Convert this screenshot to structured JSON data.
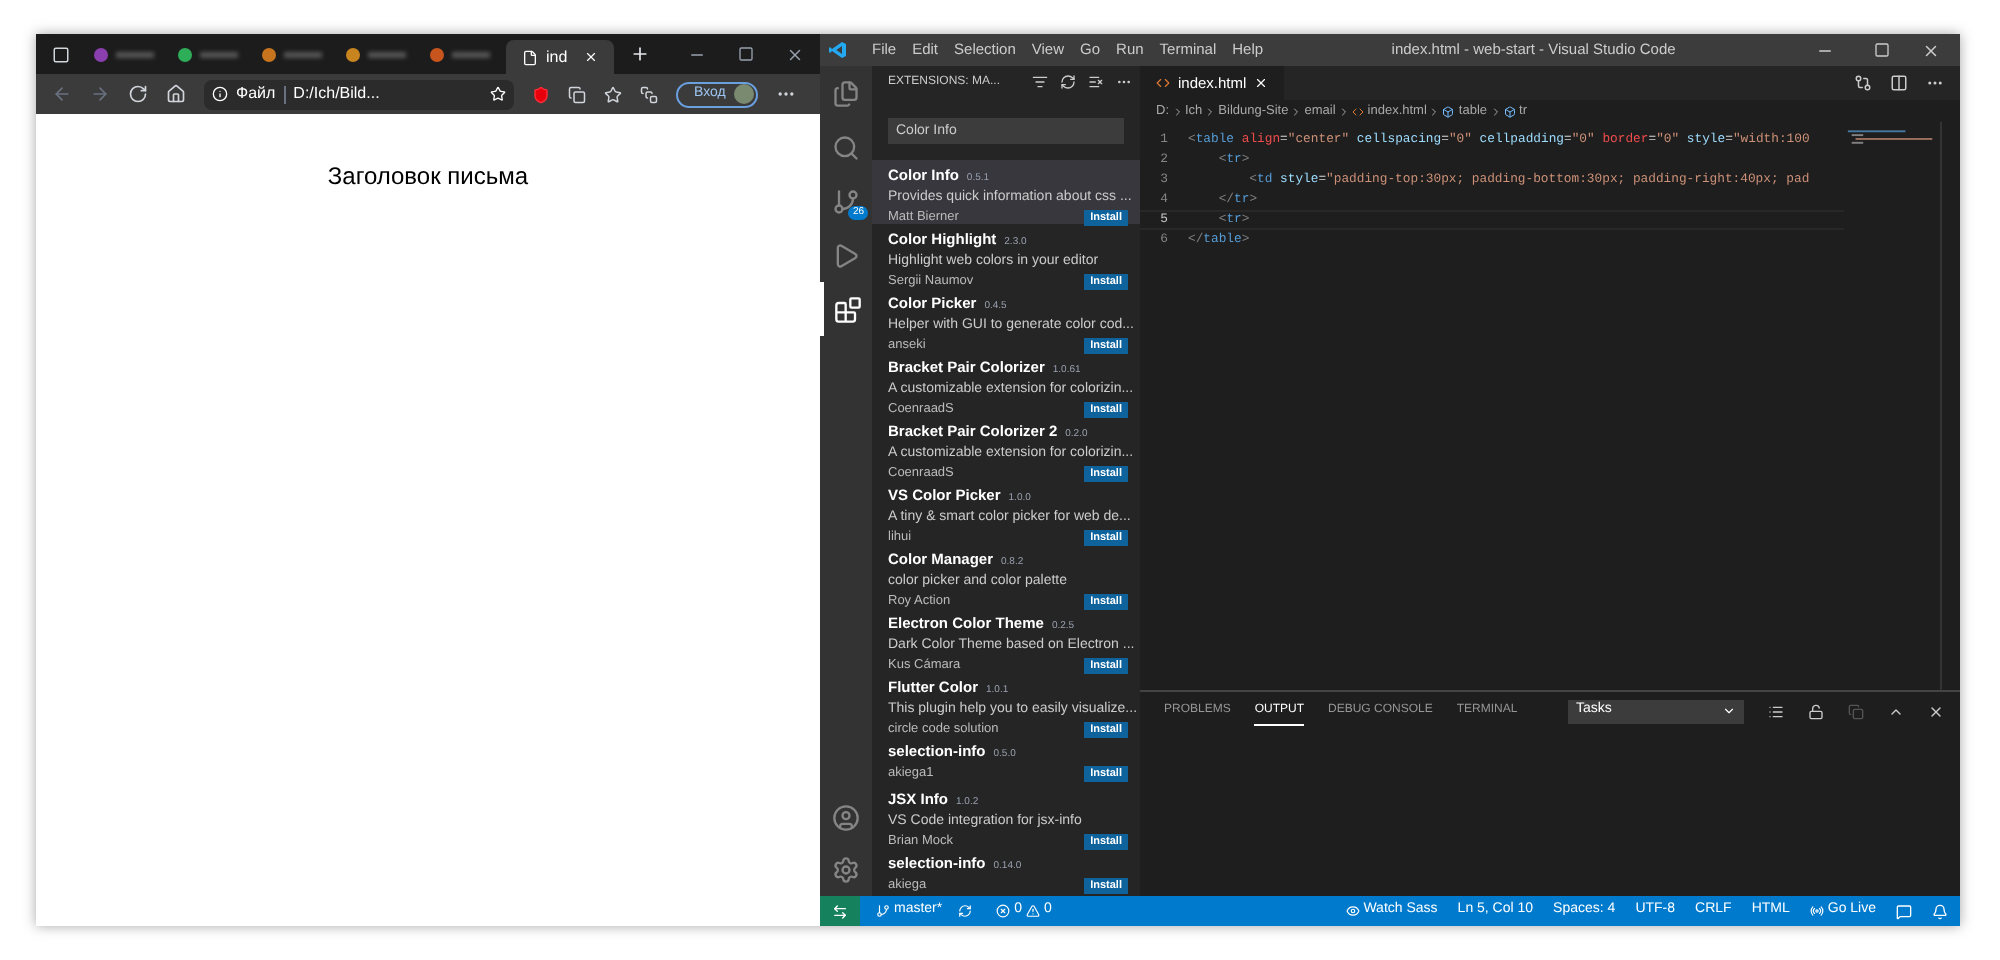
{
  "browser": {
    "blurred_tabs": [
      {
        "color": "#8a3fae"
      },
      {
        "color": "#2fae5a"
      },
      {
        "color": "#c8741e"
      },
      {
        "color": "#c8841e"
      },
      {
        "color": "#c8541e"
      }
    ],
    "active_tab": {
      "title": "ind",
      "selected": true
    },
    "address": {
      "scheme": "Файл",
      "url": "D:/Ich/Bild..."
    },
    "profile": {
      "label": "Вход"
    },
    "page": {
      "heading": "Заголовок письма"
    }
  },
  "vscode": {
    "menu": [
      "File",
      "Edit",
      "Selection",
      "View",
      "Go",
      "Run",
      "Terminal",
      "Help"
    ],
    "title": "index.html - web-start - Visual Studio Code",
    "activity": [
      {
        "kind": "files",
        "selected": false
      },
      {
        "kind": "search",
        "selected": false
      },
      {
        "kind": "scm",
        "selected": false,
        "badge": "26"
      },
      {
        "kind": "debug",
        "selected": false
      },
      {
        "kind": "extensions",
        "selected": true
      }
    ],
    "sidebar": {
      "title": "EXTENSIONS: MA...",
      "search": {
        "value": "Color Info"
      },
      "extensions": [
        {
          "name": "Color Info",
          "version": "0.5.1",
          "description": "Provides quick information about css ...",
          "author": "Matt Bierner",
          "button": "Install",
          "selected": true
        },
        {
          "name": "Color Highlight",
          "version": "2.3.0",
          "description": "Highlight web colors in your editor",
          "author": "Sergii Naumov",
          "button": "Install",
          "selected": false
        },
        {
          "name": "Color Picker",
          "version": "0.4.5",
          "description": "Helper with GUI to generate color cod...",
          "author": "anseki",
          "button": "Install",
          "selected": false
        },
        {
          "name": "Bracket Pair Colorizer",
          "version": "1.0.61",
          "description": "A customizable extension for colorizin...",
          "author": "CoenraadS",
          "button": "Install",
          "selected": false
        },
        {
          "name": "Bracket Pair Colorizer 2",
          "version": "0.2.0",
          "description": "A customizable extension for colorizin...",
          "author": "CoenraadS",
          "button": "Install",
          "selected": false
        },
        {
          "name": "VS Color Picker",
          "version": "1.0.0",
          "description": "A tiny & smart color picker for web de...",
          "author": "lihui",
          "button": "Install",
          "selected": false
        },
        {
          "name": "Color Manager",
          "version": "0.8.2",
          "description": "color picker and color palette",
          "author": "Roy Action",
          "button": "Install",
          "selected": false
        },
        {
          "name": "Electron Color Theme",
          "version": "0.2.5",
          "description": "Dark Color Theme based on Electron ...",
          "author": "Kus Cámara",
          "button": "Install",
          "selected": false
        },
        {
          "name": "Flutter Color",
          "version": "1.0.1",
          "description": "This plugin help you to easily visualize...",
          "author": "circle code solution",
          "button": "Install",
          "selected": false
        },
        {
          "name": "selection-info",
          "version": "0.5.0",
          "author": "akiega1",
          "button": "Install",
          "selected": false
        },
        {
          "name": "JSX Info",
          "version": "1.0.2",
          "description": "VS Code integration for jsx-info",
          "author": "Brian Mock",
          "button": "Install",
          "selected": false
        },
        {
          "name": "selection-info",
          "version": "0.14.0",
          "author": "akiega",
          "button": "Install",
          "selected": false
        }
      ]
    },
    "editor": {
      "tab": {
        "label": "index.html",
        "selected": true
      },
      "breadcrumbs": [
        {
          "kind": "folder",
          "label": "D:"
        },
        {
          "kind": "folder",
          "label": "Ich"
        },
        {
          "kind": "folder",
          "label": "Bildung-Site"
        },
        {
          "kind": "folder",
          "label": "email"
        },
        {
          "kind": "file",
          "label": "index.html"
        },
        {
          "kind": "symbol",
          "label": "table"
        },
        {
          "kind": "symbol",
          "label": "tr"
        }
      ],
      "lines": [
        {
          "number": "1",
          "active": false,
          "tokens": [
            {
              "kind": "p",
              "text": "<"
            },
            {
              "kind": "t",
              "text": "table"
            },
            {
              "kind": "w",
              "text": " align"
            },
            {
              "kind": "x",
              "text": "="
            },
            {
              "kind": "s",
              "text": "\"center\""
            },
            {
              "kind": "a",
              "text": " cellspacing"
            },
            {
              "kind": "x",
              "text": "="
            },
            {
              "kind": "s",
              "text": "\"0\""
            },
            {
              "kind": "a",
              "text": " cellpadding"
            },
            {
              "kind": "x",
              "text": "="
            },
            {
              "kind": "s",
              "text": "\"0\""
            },
            {
              "kind": "w",
              "text": " border"
            },
            {
              "kind": "x",
              "text": "="
            },
            {
              "kind": "s",
              "text": "\"0\""
            },
            {
              "kind": "a",
              "text": " style"
            },
            {
              "kind": "x",
              "text": "="
            },
            {
              "kind": "s",
              "text": "\"width:100"
            }
          ]
        },
        {
          "number": "2",
          "active": false,
          "tokens": [
            {
              "kind": "p",
              "text": "    <"
            },
            {
              "kind": "t",
              "text": "tr"
            },
            {
              "kind": "p",
              "text": ">"
            }
          ]
        },
        {
          "number": "3",
          "active": false,
          "tokens": [
            {
              "kind": "p",
              "text": "        <"
            },
            {
              "kind": "t",
              "text": "td"
            },
            {
              "kind": "a",
              "text": " style"
            },
            {
              "kind": "x",
              "text": "="
            },
            {
              "kind": "s",
              "text": "\"padding-top:30px; padding-bottom:30px; padding-right:40px; pad"
            }
          ]
        },
        {
          "number": "4",
          "active": false,
          "tokens": [
            {
              "kind": "p",
              "text": "    </"
            },
            {
              "kind": "t",
              "text": "tr"
            },
            {
              "kind": "p",
              "text": ">"
            }
          ]
        },
        {
          "number": "5",
          "active": true,
          "tokens": [
            {
              "kind": "p",
              "text": "    <"
            },
            {
              "kind": "t",
              "text": "tr"
            },
            {
              "kind": "p",
              "text": ">"
            }
          ]
        },
        {
          "number": "6",
          "active": false,
          "tokens": [
            {
              "kind": "p",
              "text": "</"
            },
            {
              "kind": "t",
              "text": "table"
            },
            {
              "kind": "p",
              "text": ">"
            }
          ]
        }
      ]
    },
    "panel": {
      "tabs": [
        {
          "label": "PROBLEMS",
          "selected": false
        },
        {
          "label": "OUTPUT",
          "selected": true
        },
        {
          "label": "DEBUG CONSOLE",
          "selected": false
        },
        {
          "label": "TERMINAL",
          "selected": false
        }
      ],
      "dropdown": "Tasks"
    },
    "status": {
      "branch": "master*",
      "errors": "0",
      "warnings": "0",
      "items": [
        {
          "kind": "watch",
          "label": "Watch Sass"
        },
        {
          "kind": "text",
          "label": "Ln 5, Col 10"
        },
        {
          "kind": "text",
          "label": "Spaces: 4"
        },
        {
          "kind": "text",
          "label": "UTF-8"
        },
        {
          "kind": "text",
          "label": "CRLF"
        },
        {
          "kind": "text",
          "label": "HTML"
        },
        {
          "kind": "live",
          "label": "Go Live"
        }
      ]
    }
  }
}
